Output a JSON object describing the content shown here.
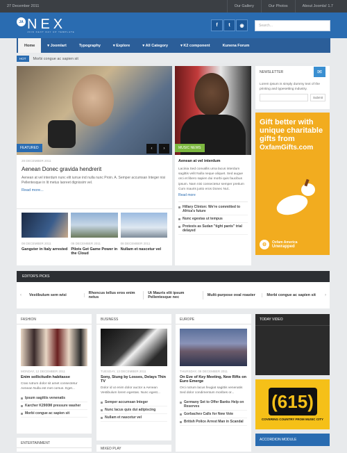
{
  "topbar": {
    "date": "27 December 2011",
    "links": [
      "Our Gallery",
      "Our Photos",
      "About Joomla! 1.7"
    ]
  },
  "header": {
    "logo_badge": "JA",
    "logo": "NEX",
    "tagline": "JOIN NEXT DAY UP TEMPLATE",
    "search_placeholder": "Search..."
  },
  "nav": [
    "Home",
    "Joomlart",
    "Typography",
    "Explore",
    "All Category",
    "K2 component",
    "Kunena Forum"
  ],
  "hot": {
    "label": "HOT",
    "text": "Morbi congue ac sapien sit"
  },
  "featured": {
    "tag": "FEATURED",
    "date": "28 DECEMBER 2011",
    "title": "Aenean Donec gravida hendrerit",
    "body": "Aenean at vel interdum nunc elit iurrue ind nulla nunc Proin. A. Semper accumsan Integer nisi Pellentesque in lit metus laoreet dignissim vel.",
    "readmore": "Read more..."
  },
  "music": {
    "tag": "MUSIC NEWS",
    "title": "Aenean at vel interdum",
    "body": "Lacinia Sed convallis urna lacus interdum sagittis velit Nulla neque aliquet. Sed augue orci et libero sapien dui morbi quis faucibus ipsum. Nam nisi consectetur semper pretium Cum mauris justo eros Donec Nul..",
    "readmore": "Read more",
    "items": [
      "Hillary Clinton: We're committed to Africa's future",
      "Nunc egestas ut tempus",
      "Protests as Sudan \"tight pants\" trial delayed"
    ]
  },
  "thumbs": [
    {
      "date": "08 DECEMBER 2011",
      "title": "Gangster in Italy arrested"
    },
    {
      "date": "08 DECEMBER 2011",
      "title": "Pilots Get Game Power in the Cloud"
    },
    {
      "date": "08 DECEMBER 2011",
      "title": "Nullam et nascetur vel"
    }
  ],
  "newsletter": {
    "title": "NEWSLETTER",
    "text": "Lorem ipsum is simply dummy text of the printing and typesetting industry.",
    "submit": "Submit"
  },
  "ad": {
    "line1": "Gift better with unique charitable gifts from",
    "line2": "OxfamGifts.com",
    "footer1": "Oxfam America",
    "footer2": "Unwrapped"
  },
  "editors": {
    "title": "EDITOR'S PICKS",
    "items": [
      "Vestibulum sem wisi",
      "Rhoncus tellus eros enim netus",
      "Ut Mauris elit ipsum Pellentesque nec",
      "Multi-purpose oval roaster",
      "Morbi congue ac sapien sit"
    ]
  },
  "fashion": {
    "title": "FASHION",
    "date": "MONDAY, 12 DECEMBER 2011",
    "headline": "Enim sollicitudin habitasse",
    "body": "Cras rutrum dolor sit amet consectetur Aenean Nulla est met corsus. Eget...",
    "items": [
      "Ipsum sagittis venenatis",
      "Karcher K2900M pressure washer",
      "Morbi congue ac sapien sit"
    ]
  },
  "business": {
    "title": "BUSINESS",
    "date": "TUESDAY, 13 DECEMBER 2011",
    "headline": "Sony, Stung by Losses, Delays Thin TV",
    "body": "Dolor id ut enim dolor auctor a Aenean Vestibulum lorem egestas. Nunc egest...",
    "items": [
      "Semper accumsan Integer",
      "Nunc lacus quis dui adipiscing",
      "Nullam et nascetur vel"
    ]
  },
  "europe": {
    "title": "EUROPE",
    "date": "THURSDAY, 08 DECEMBER 2011",
    "headline": "On Eve of Key Meeting, New Rifts on Euro Emerge",
    "body": "Orci rutrum lacus feugiat sagittis venenatis Sed dolor condimentum moribes or...",
    "items": [
      "Germany Set to Offer Banks Help on Reserves",
      "Gorbachev Calls for New Vote",
      "British Police Arrest Man in Scandal"
    ]
  },
  "today_video": "TODAY VIDEO",
  "ad2": {
    "num": "615",
    "tag": "COVERING COUNTRY FROM MUSIC CITY"
  },
  "accordion": "ACCORDION MODULE",
  "entertainment": "ENTERTAINMENT",
  "mixed": "MIXED PLAY"
}
